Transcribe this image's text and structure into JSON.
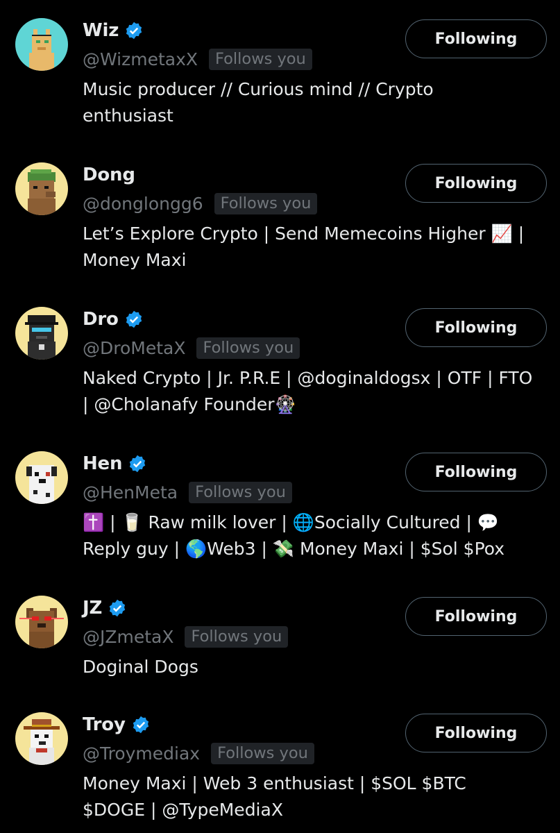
{
  "accent_color": "#1d9bf0",
  "users": [
    {
      "name": "Wiz",
      "verified": true,
      "handle": "@WizmetaxX",
      "follows_badge": "Follows you",
      "bio": "Music producer // Curious mind // Crypto\nenthusiast",
      "button_label": "Following",
      "avatar_icon": "pixel-alpaca-avatar",
      "avatar_bg": "#5fd5d5"
    },
    {
      "name": "Dong",
      "verified": false,
      "handle": "@donglongg6",
      "follows_badge": "Follows you",
      "bio": "Let’s Explore Crypto | Send Memecoins Higher 📈 |\nMoney Maxi",
      "button_label": "Following",
      "avatar_icon": "pixel-dog-green-hair-avatar",
      "avatar_bg": "#f5e49a"
    },
    {
      "name": "Dro",
      "verified": true,
      "handle": "@DroMetaX",
      "follows_badge": "Follows you",
      "bio": "Naked Crypto | Jr. P.R.E | @doginaldogsx | OTF | FTO\n| @Cholanafy Founder🎡",
      "button_label": "Following",
      "avatar_icon": "pixel-dog-police-cap-avatar",
      "avatar_bg": "#f5e49a"
    },
    {
      "name": "Hen",
      "verified": true,
      "handle": "@HenMeta",
      "follows_badge": "Follows you",
      "bio": "✝️ | 🥛 Raw milk lover | 🌐Socially Cultured | 💬\nReply guy | 🌎Web3 | 💸 Money Maxi | $Sol $Pox",
      "button_label": "Following",
      "avatar_icon": "pixel-dalmatian-avatar",
      "avatar_bg": "#f5e49a"
    },
    {
      "name": "JZ",
      "verified": true,
      "handle": "@JZmetaX",
      "follows_badge": "Follows you",
      "bio": "Doginal Dogs",
      "button_label": "Following",
      "avatar_icon": "pixel-dog-laser-eyes-avatar",
      "avatar_bg": "#f5e49a"
    },
    {
      "name": "Troy",
      "verified": true,
      "handle": "@Troymediax",
      "follows_badge": "Follows you",
      "bio": "Money Maxi | Web 3 enthusiast | $SOL $BTC\n$DOGE | @TypeMediaX",
      "button_label": "Following",
      "avatar_icon": "pixel-dog-cowboy-hat-avatar",
      "avatar_bg": "#f5e49a"
    }
  ]
}
